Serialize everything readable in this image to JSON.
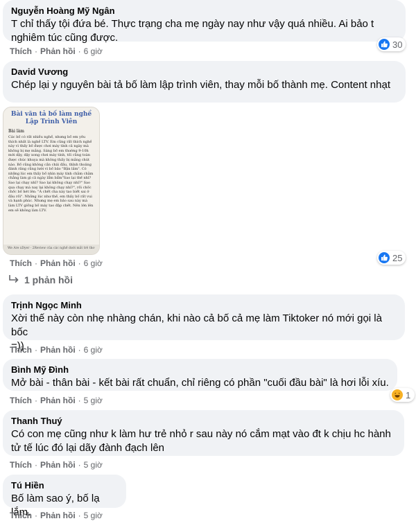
{
  "labels": {
    "like": "Thích",
    "reply": "Phản hồi",
    "sep": "·"
  },
  "comments": [
    {
      "name": "Nguyễn Hoàng Mỹ Ngân",
      "line1": "T chỉ thấy tội đứa bé. Thực trạng cha mẹ ngày nay như vậy quá nhiều. Ai bảo t",
      "line2": "nghiêm túc cũng được.",
      "time": "6 giờ",
      "reaction_count": "30"
    },
    {
      "name": "David Vương",
      "line1": "Chép lại y nguyên bài tả bố làm lập trình viên, thay mỗi bố thành mẹ. Content nhạt",
      "time": "6 giờ",
      "reaction_count": "25"
    },
    {
      "name": "Trịnh Ngọc Minh",
      "line1": "Xời thế này còn nhẹ nhàng chán, khi nào cả bố cả mẹ làm Tiktoker nó mới gọi là bốc",
      "line2": "=))",
      "time": "6 giờ"
    },
    {
      "name": "Bình Mỹ Đình",
      "line1": "Mở bài - thân bài - kết bài rất chuẩn, chỉ riêng có phần \"cuối đầu bài\" là hơi lỗi xíu.",
      "time": "5 giờ",
      "reaction_count": "1"
    },
    {
      "name": "Thanh Thuý",
      "line1": "Có con mẹ cũng như k làm hư trẻ nhỏ r sau này nó cắm mạt vào đt k chịu hc hành",
      "line2": "tử tế lúc đó lại dãy đành đạch lên",
      "time": "5 giờ"
    },
    {
      "name": "Tú Hiền",
      "line1": "Bố làm sao ý, bố lạ lắm.",
      "time": "5 giờ"
    }
  ],
  "image_doc": {
    "title1": "Bài văn tả bố làm nghề",
    "title2": "Lập Trình Viên",
    "heading": "Bài làm",
    "body": "Các bố có rất nhiều nghề, nhưng bố em yêu thích nhất là nghề LTV. Em cũng rất thích nghề này vì thấy bố được chơi máy tính cả ngày mà không bị mẹ mắng. Sáng bố em thường 9-10h mới dậy, dậy xong chơi máy tính, tối cũng toàn được chúc khuya mà không thấy bị mắng chút nào. Bố cũng không cần chải đầu, thỉnh thoảng đánh răng cũng lười vì bố bảo \"Bận lắm\". Có những lúc em thấy bố nhìn máy tính chằm chằm chẳng làm gì cả ngày lẩm bẩm\"Sao lại thế nhỉ? Sao lại chạy nhỉ? Sao lại không chạy nhỉ?\" Sao qua chạy mà nay lại không chạy nhỉ?\", rồi chốc chốc bố hét lên: \"À chết cha này tao biết sai ở đâu rồi\". Những lúc như thế, em thấy bố rất vui và hạnh phúc. Nhưng mẹ em bảo sau này mà làm LTV giống bố máy tao đập chết. Nên lớn lên em sẽ không làm LTV.",
    "footer": "We Are xDyer · 2Review của các nghề dưới mắt trẻ thơ"
  },
  "replies_label": "1 phản hồi",
  "colors": {
    "like_blue": "#1877f2",
    "haha_yellow": "#f7b125",
    "bubble_bg": "#f0f2f5",
    "meta_gray": "#65676b"
  }
}
